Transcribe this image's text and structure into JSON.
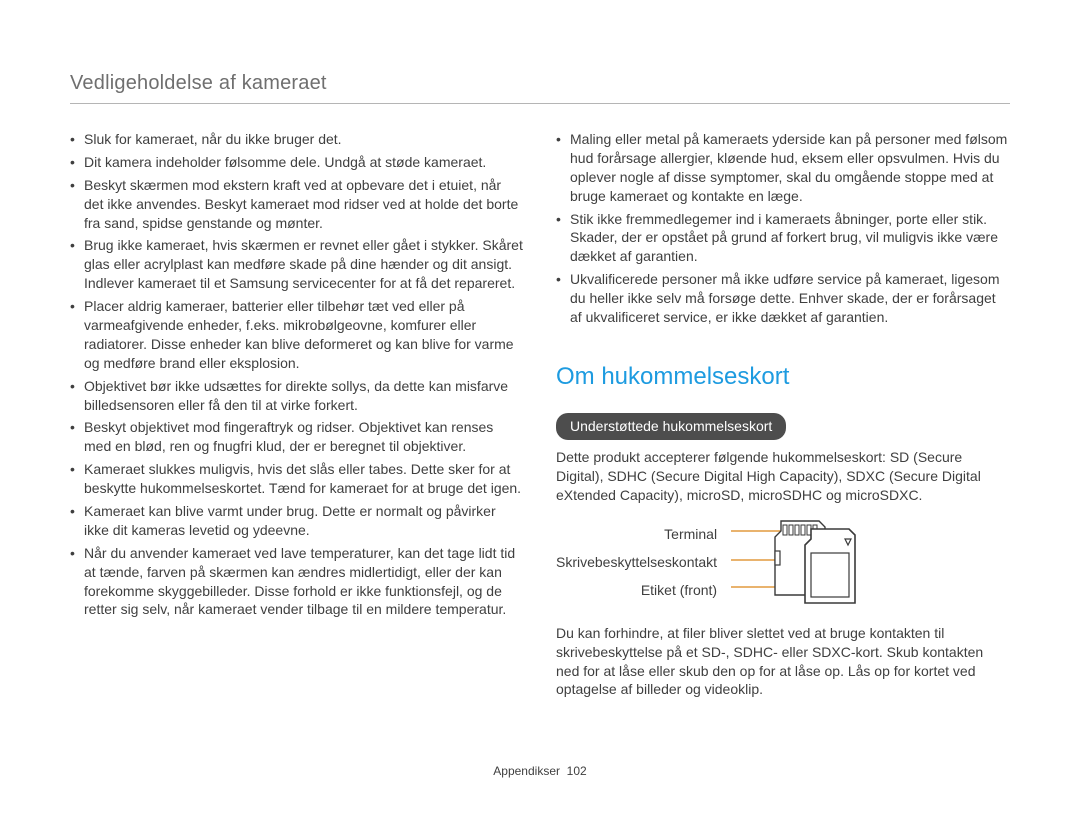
{
  "header": {
    "title": "Vedligeholdelse af kameraet"
  },
  "left": {
    "items": [
      "Sluk for kameraet, når du ikke bruger det.",
      "Dit kamera indeholder følsomme dele. Undgå at støde kameraet.",
      "Beskyt skærmen mod ekstern kraft ved at opbevare det i etuiet, når det ikke anvendes. Beskyt kameraet mod ridser ved at holde det borte fra sand, spidse genstande og mønter.",
      "Brug ikke kameraet, hvis skærmen er revnet eller gået i stykker. Skåret glas eller acrylplast kan medføre skade på dine hænder og dit ansigt. Indlever kameraet til et Samsung servicecenter for at få det repareret.",
      "Placer aldrig kameraer, batterier eller tilbehør tæt ved eller på varmeafgivende enheder, f.eks. mikrobølgeovne, komfurer eller radiatorer. Disse enheder kan blive deformeret og kan blive for varme og medføre brand eller eksplosion.",
      "Objektivet bør ikke udsættes for direkte sollys, da dette kan misfarve billedsensoren eller få den til at virke forkert.",
      "Beskyt objektivet mod fingeraftryk og ridser. Objektivet kan renses med en blød, ren og fnugfri klud, der er beregnet til objektiver.",
      "Kameraet slukkes muligvis, hvis det slås eller tabes. Dette sker for at beskytte hukommelseskortet. Tænd for kameraet for at bruge det igen.",
      "Kameraet kan blive varmt under brug. Dette er normalt og påvirker ikke dit kameras levetid og ydeevne.",
      "Når du anvender kameraet ved lave temperaturer, kan det tage lidt tid at tænde, farven på skærmen kan ændres midlertidigt, eller der kan forekomme skyggebilleder. Disse forhold er ikke funktionsfejl, og de retter sig selv, når kameraet vender tilbage til en mildere temperatur."
    ]
  },
  "right_top": {
    "items": [
      "Maling eller metal på kameraets yderside kan på personer med følsom hud forårsage allergier, kløende hud, eksem eller opsvulmen. Hvis du oplever nogle af disse symptomer, skal du omgående stoppe med at bruge kameraet og kontakte en læge.",
      "Stik ikke fremmedlegemer ind i kameraets åbninger, porte eller stik. Skader, der er opstået på grund af forkert brug, vil muligvis ikke være dækket af garantien.",
      "Ukvalificerede personer må ikke udføre service på kameraet, ligesom du heller ikke selv må forsøge dette. Enhver skade, der er forårsaget af ukvalificeret service, er ikke dækket af garantien."
    ]
  },
  "memory": {
    "title": "Om hukommelseskort",
    "pill": "Understøttede hukommelseskort",
    "intro": "Dette produkt accepterer følgende hukommelseskort: SD (Secure Digital), SDHC (Secure Digital High Capacity), SDXC (Secure Digital eXtended Capacity), microSD, microSDHC og microSDXC.",
    "labels": {
      "terminal": "Terminal",
      "wp": "Skrivebeskyttelseskontakt",
      "label": "Etiket (front)"
    },
    "outro": "Du kan forhindre, at filer bliver slettet ved at bruge kontakten til skrivebeskyttelse på et SD-, SDHC- eller SDXC-kort. Skub kontakten ned for at låse eller skub den op for at låse op. Lås op for kortet ved optagelse af billeder og videoklip."
  },
  "footer": {
    "section": "Appendikser",
    "page": "102"
  },
  "colors": {
    "accent": "#1d9be0",
    "pointer": "#e29a3f"
  }
}
